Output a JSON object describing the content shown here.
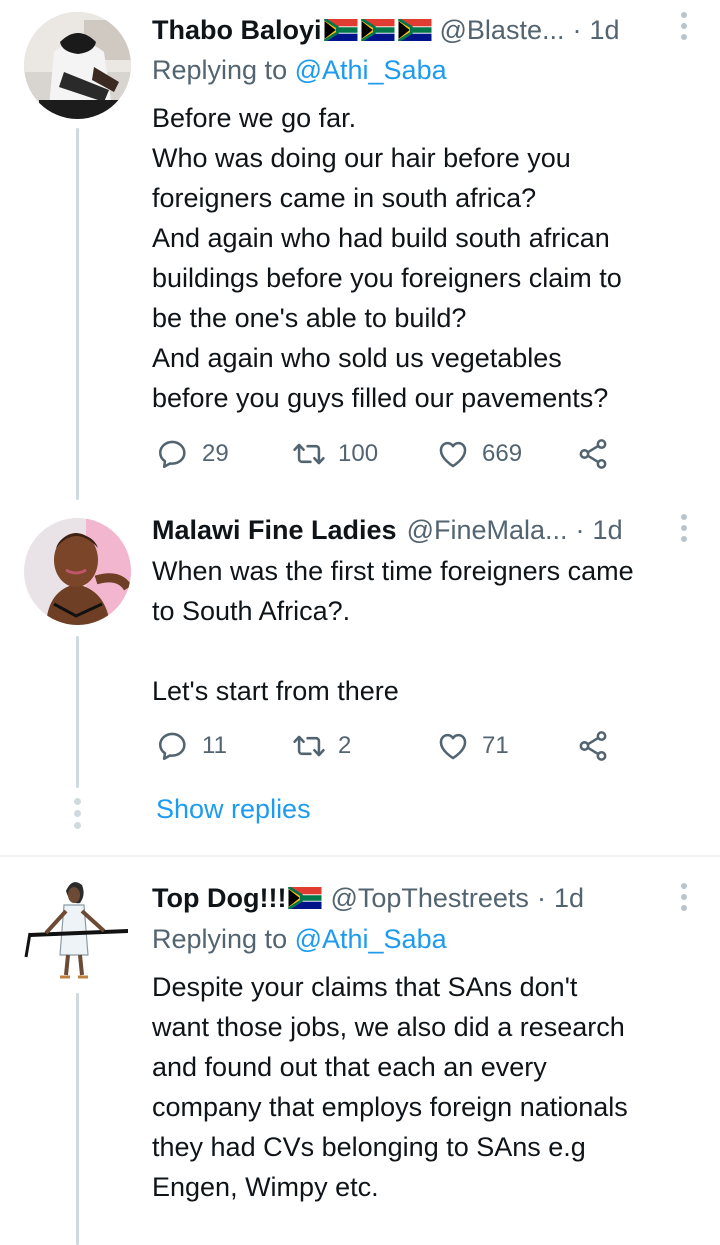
{
  "colors": {
    "accent": "#1d9bf0",
    "muted": "#536471",
    "text": "#0f1419",
    "line": "#cfd9de"
  },
  "tweets": [
    {
      "name": "Thabo Baloyi",
      "flag_icons": [
        "south-africa-flag-icon",
        "south-africa-flag-icon",
        "south-africa-flag-icon"
      ],
      "handle": "@Blaste...",
      "dot": "·",
      "time": "1d",
      "replying_prefix": "Replying to ",
      "replying_to": "@Athi_Saba",
      "lines": [
        "Before we go far.",
        "Who was doing our hair before you",
        "foreigners came in south africa?",
        "And again who had build south african",
        "buildings before you foreigners claim to",
        "be the one's able to build?",
        "And again who sold us vegetables",
        "before you guys filled our pavements?"
      ],
      "replies": "29",
      "retweets": "100",
      "likes": "669"
    },
    {
      "name": "Malawi Fine Ladies",
      "handle": "@FineMala...",
      "dot": "·",
      "time": "1d",
      "lines": [
        "When was the first time foreigners came",
        "to South Africa?.",
        "",
        "Let's start from there"
      ],
      "replies": "11",
      "retweets": "2",
      "likes": "71",
      "show_replies": "Show replies"
    },
    {
      "name": "Top Dog!!!",
      "flag_icons": [
        "south-africa-flag-icon"
      ],
      "handle": "@TopThestreets",
      "dot": "·",
      "time": "1d",
      "replying_prefix": "Replying to ",
      "replying_to": "@Athi_Saba",
      "lines": [
        "Despite your claims that SAns don't",
        "want those jobs, we also did a research",
        "and found out that each an every",
        "company that employs foreign nationals",
        "they had CVs belonging to SAns e.g",
        "Engen, Wimpy etc."
      ]
    }
  ]
}
